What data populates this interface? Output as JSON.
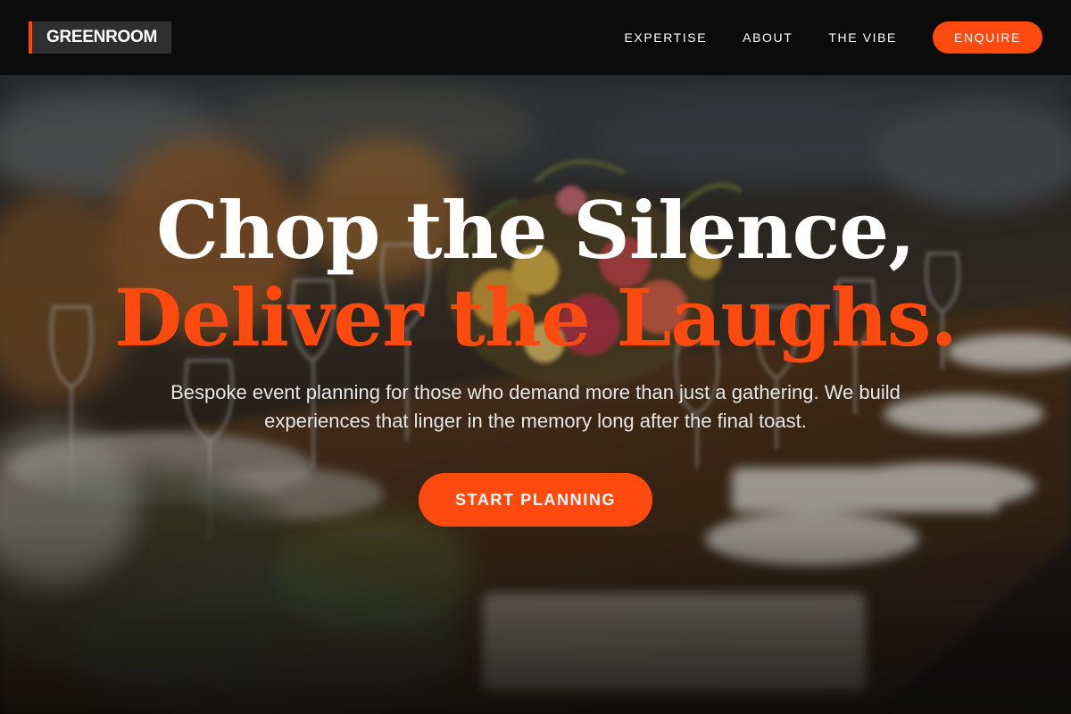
{
  "header": {
    "logo_text": "GREENROOM",
    "nav": [
      {
        "label": "EXPERTISE"
      },
      {
        "label": "ABOUT"
      },
      {
        "label": "THE VIBE"
      }
    ],
    "enquire_label": "ENQUIRE"
  },
  "hero": {
    "headline_line1": "Chop the Silence,",
    "headline_line2": "Deliver the Laughs.",
    "subtext": "Bespoke event planning for those who demand more than just a gathering. We build experiences that linger in the memory long after the final toast.",
    "cta_label": "START PLANNING"
  },
  "colors": {
    "accent": "#ff4a0f",
    "navbar_bg": "#0b0b0b",
    "logo_bg": "#2f2f2f",
    "text_light": "#ffffff"
  }
}
